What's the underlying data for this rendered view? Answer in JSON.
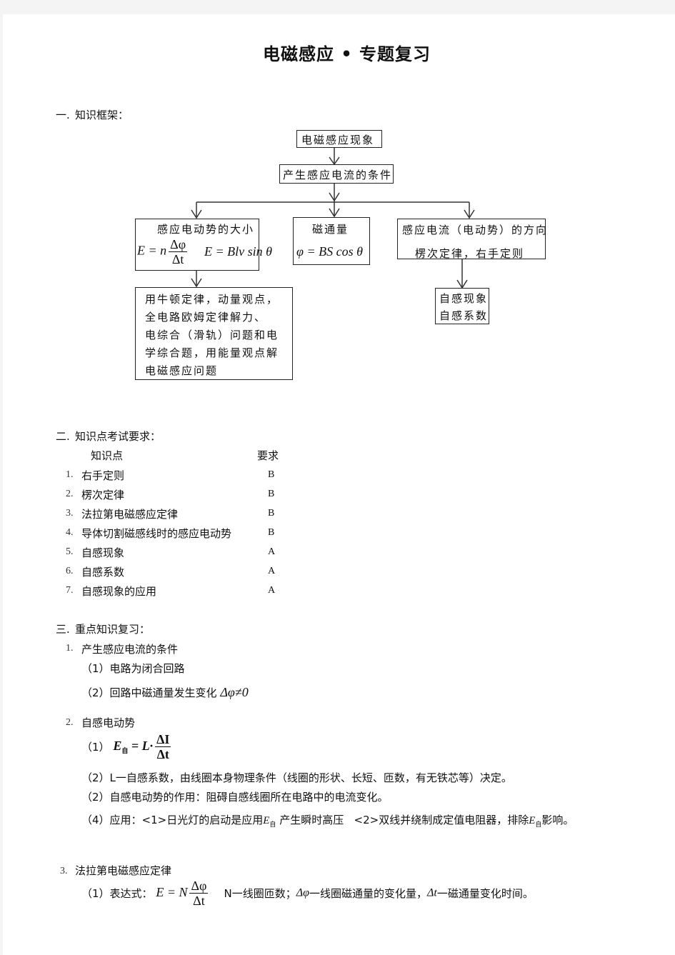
{
  "title": "电磁感应 • 专题复习",
  "section1": {
    "label": "一.",
    "heading": "知识框架：",
    "flowchart": {
      "node_phenomenon": "电磁感应现象",
      "node_condition": "产生感应电流的条件",
      "node_emf_magnitude": {
        "title": "感应电动势的大小",
        "formula1_lhs": "E = n",
        "formula1_num": "Δφ",
        "formula1_den": "Δt",
        "formula2": "E = Blv sin θ"
      },
      "node_flux": {
        "title": "磁通量",
        "formula": "φ = BS cos θ"
      },
      "node_direction": {
        "title": "感应电流（电动势）的方向",
        "subtitle": "楞次定律，右手定则"
      },
      "node_methods": {
        "lines": [
          "用牛顿定律，动量观点，",
          "全电路欧姆定律解力、",
          "电综合（滑轨）问题和电",
          "学综合题，用能量观点解",
          "电磁感应问题"
        ]
      },
      "node_self_induction": {
        "lines": [
          "自感现象",
          "自感系数"
        ]
      }
    }
  },
  "section2": {
    "label": "二.",
    "heading": "知识点考试要求：",
    "col_topic": "知识点",
    "col_requirement": "要求",
    "rows": [
      {
        "num": "1.",
        "topic": "右手定则",
        "grade": "B"
      },
      {
        "num": "2.",
        "topic": "楞次定律",
        "grade": "B"
      },
      {
        "num": "3.",
        "topic": "法拉第电磁感应定律",
        "grade": "B"
      },
      {
        "num": "4.",
        "topic": "导体切割磁感线时的感应电动势",
        "grade": "B"
      },
      {
        "num": "5.",
        "topic": "自感现象",
        "grade": "A"
      },
      {
        "num": "6.",
        "topic": "自感系数",
        "grade": "A"
      },
      {
        "num": "7.",
        "topic": "自感现象的应用",
        "grade": "A"
      }
    ]
  },
  "section3": {
    "label": "三.",
    "heading": "重点知识复习：",
    "item1": {
      "num": "1.",
      "title": "产生感应电流的条件",
      "sub1": "（1）电路为闭合回路",
      "sub2_text": "（2）回路中磁通量发生变化",
      "sub2_math": "Δφ≠0"
    },
    "item2": {
      "num": "2.",
      "title": "自感电动势",
      "sub1_prefix": "（1）",
      "sub1_lhs": "E",
      "sub1_subscript": "自",
      "sub1_mid": "= L·",
      "sub1_num": "ΔI",
      "sub1_den": "Δt",
      "sub2": "（2）L一自感系数，由线圈本身物理条件（线圈的形状、长短、匝数，有无铁芯等）决定。",
      "sub3": "（2）自感电动势的作用：阻碍自感线圈所在电路中的电流变化。",
      "sub4_a": "（4）应用：<1>日光灯的启动是应用",
      "sub4_b": "产生瞬时高压",
      "sub4_c": "<2>双线并绕制成定值电阻器，排除",
      "sub4_d": "影响。",
      "e_symbol": "E",
      "e_sub": "自"
    },
    "item3": {
      "num": "3.",
      "title": "法拉第电磁感应定律",
      "sub1_prefix": "（1）表达式：",
      "formula_lhs": "E = N",
      "formula_num": "Δφ",
      "formula_den": "Δt",
      "desc_n": "N一线圈匝数；",
      "desc_dphi_sym": "Δφ",
      "desc_dphi": "一线圈磁通量的变化量，",
      "desc_dt_sym": "Δt",
      "desc_dt": "一磁通量变化时间。"
    }
  }
}
